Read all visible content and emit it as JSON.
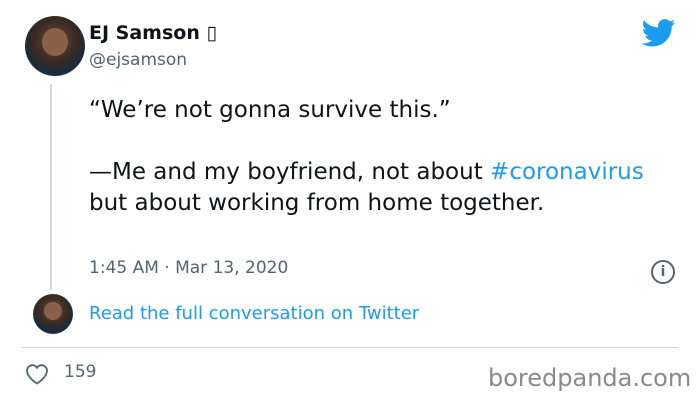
{
  "tweet": {
    "author": {
      "name": "EJ Samson ▯",
      "handle": "@ejsamson"
    },
    "text": {
      "quote": "“We’re not gonna survive this.”",
      "line_prefix": "—Me and my boyfriend, not about ",
      "hashtag": "#coronavirus",
      "line_suffix": " but about working from home together."
    },
    "time": "1:45 AM · Mar 13, 2020",
    "info_icon": "info-icon",
    "read_link": "Read the full conversation on Twitter",
    "likes": "159"
  },
  "watermark": "boredpanda.com",
  "icons": {
    "logo": "twitter-bird-icon",
    "like": "heart-icon",
    "info": "info-icon"
  },
  "colors": {
    "accent": "#1d9bf0",
    "text": "#0f1419",
    "muted": "#536471",
    "watermark": "#8a8a8a"
  }
}
